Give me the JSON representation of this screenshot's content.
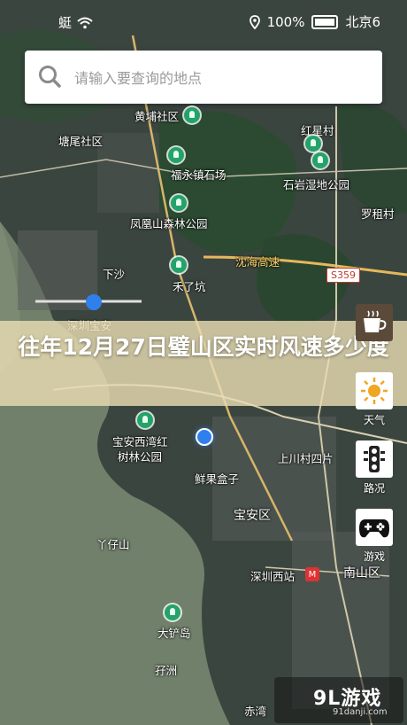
{
  "status_bar": {
    "left_text": "蜓",
    "wifi_icon": "wifi-icon",
    "location_icon": "location-pin-icon",
    "battery_text": "100%",
    "battery_icon": "battery-icon",
    "right_text": "北京6"
  },
  "search": {
    "placeholder": "请输入要查询的地点",
    "icon": "search-icon"
  },
  "map": {
    "labels": [
      {
        "text": "黄埔社区"
      },
      {
        "text": "红星村"
      },
      {
        "text": "塘尾社区"
      },
      {
        "text": "福永镇石场"
      },
      {
        "text": "石岩湿地公园"
      },
      {
        "text": "凤凰山森林公园"
      },
      {
        "text": "罗租村"
      },
      {
        "text": "下沙"
      },
      {
        "text": "沈海高速"
      },
      {
        "text": "禾了坑"
      },
      {
        "text": "深圳宝安"
      },
      {
        "text": "宝安西湾红"
      },
      {
        "text": "树林公园"
      },
      {
        "text": "鲜果盒子"
      },
      {
        "text": "上川村四片"
      },
      {
        "text": "宝安区"
      },
      {
        "text": "丫仔山"
      },
      {
        "text": "深圳西站"
      },
      {
        "text": "南山区"
      },
      {
        "text": "大铲岛"
      },
      {
        "text": "孖洲"
      },
      {
        "text": "赤湾"
      }
    ],
    "road_badge": "S359"
  },
  "banner": {
    "title": "往年12月27日璧山区实时风速多少度"
  },
  "side_buttons": [
    {
      "icon": "coffee-cup-icon",
      "label": ""
    },
    {
      "icon": "sun-icon",
      "label": "天气"
    },
    {
      "icon": "traffic-light-icon",
      "label": "路况"
    },
    {
      "icon": "gamepad-icon",
      "label": "游戏"
    }
  ],
  "watermark": {
    "logo": "9L游戏",
    "url": "91danji.com"
  },
  "colors": {
    "map_green": "#2f4a36",
    "water": "#6b7d6a",
    "banner": "#e8dcb2",
    "accent_blue": "#2f80ed"
  }
}
